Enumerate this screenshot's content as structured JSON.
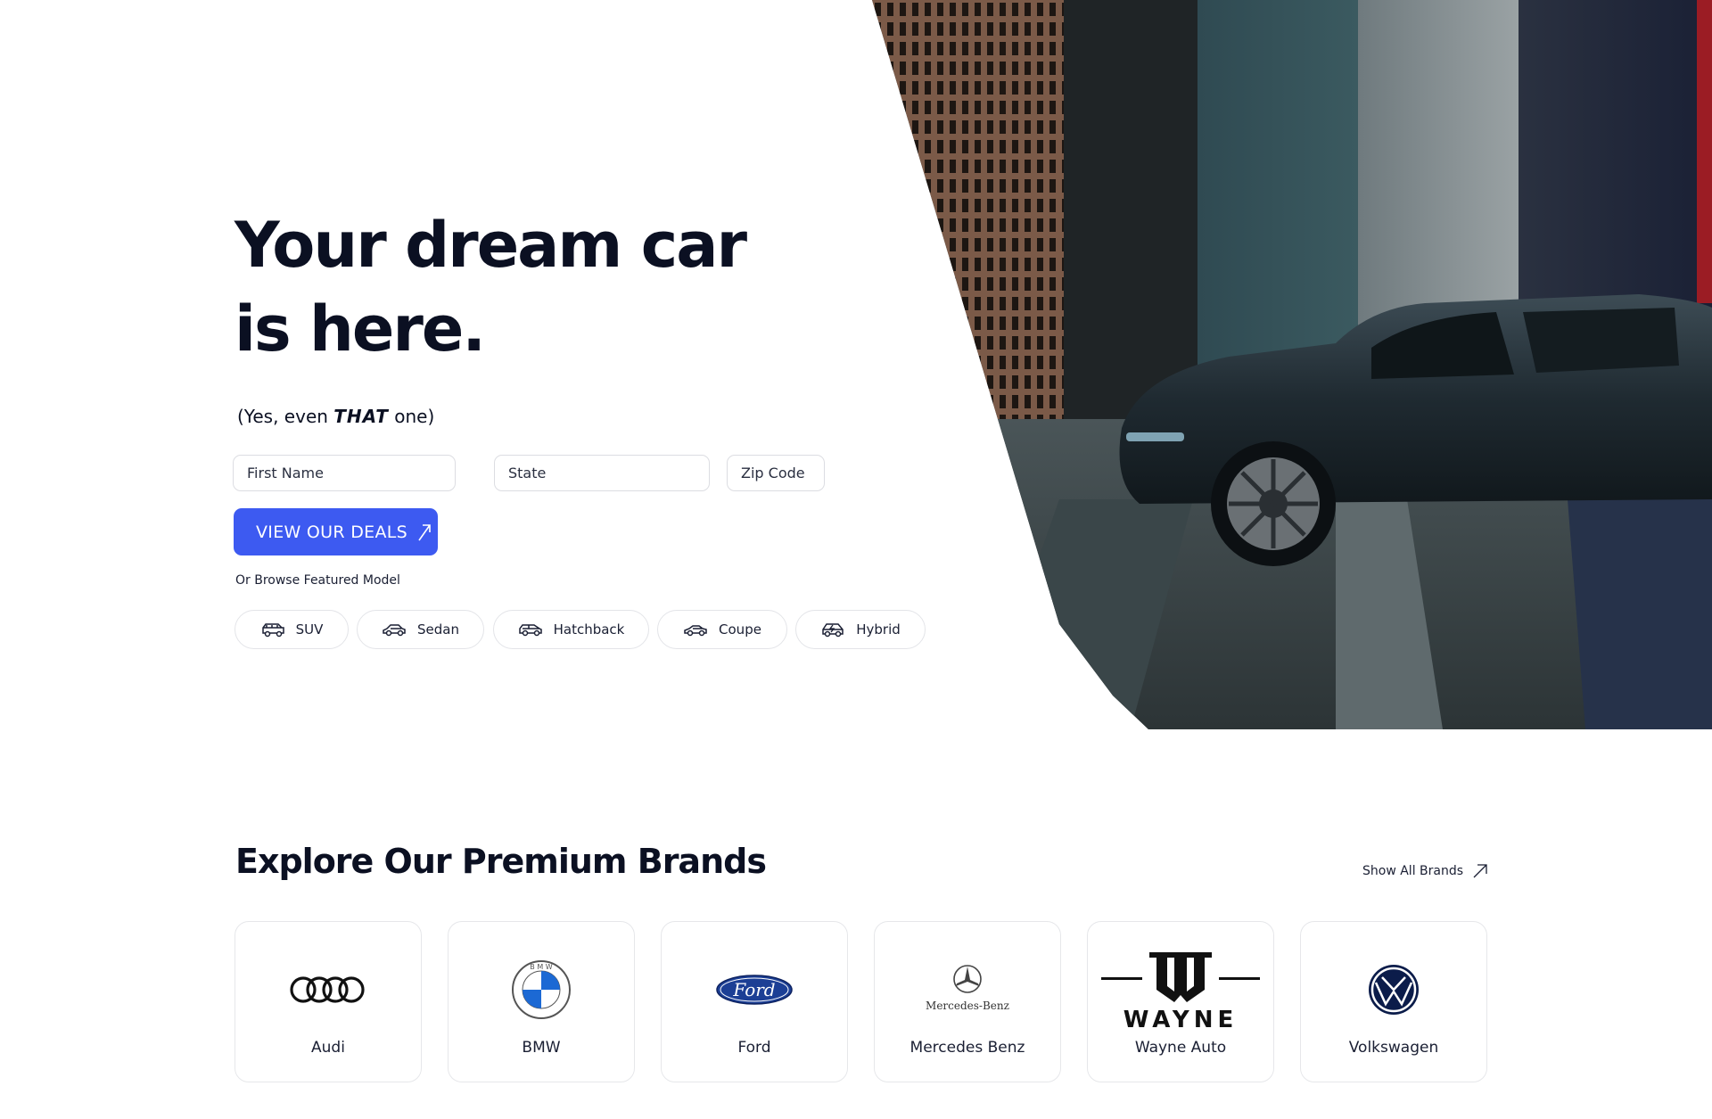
{
  "hero": {
    "headline": "Your dream car is here.",
    "sub_prefix": "(Yes, even ",
    "sub_emphasis": "THAT",
    "sub_suffix": " one)"
  },
  "form": {
    "first_name_placeholder": "First Name",
    "state_placeholder": "State",
    "zip_placeholder": "Zip Code",
    "cta_label": "VIEW OUR DEALS"
  },
  "browse": {
    "label": "Or Browse Featured Model",
    "models": [
      {
        "label": "SUV",
        "icon": "suv-icon"
      },
      {
        "label": "Sedan",
        "icon": "sedan-icon"
      },
      {
        "label": "Hatchback",
        "icon": "hatchback-icon"
      },
      {
        "label": "Coupe",
        "icon": "coupe-icon"
      },
      {
        "label": "Hybrid",
        "icon": "hybrid-icon"
      }
    ]
  },
  "brands": {
    "title": "Explore Our Premium Brands",
    "show_all": "Show All Brands",
    "items": [
      {
        "name": "Audi",
        "logo": "audi-logo"
      },
      {
        "name": "BMW",
        "logo": "bmw-logo",
        "logo_text": "B M W"
      },
      {
        "name": "Ford",
        "logo": "ford-logo",
        "logo_text": "Ford"
      },
      {
        "name": "Mercedes Benz",
        "logo": "mercedes-logo",
        "logo_text": "Mercedes-Benz"
      },
      {
        "name": "Wayne Auto",
        "logo": "wayne-logo",
        "logo_text": "WAYNE"
      },
      {
        "name": "Volkswagen",
        "logo": "vw-logo"
      }
    ]
  },
  "colors": {
    "accent": "#3d5af1",
    "text": "#0b1022",
    "border": "#e3e4e8"
  }
}
